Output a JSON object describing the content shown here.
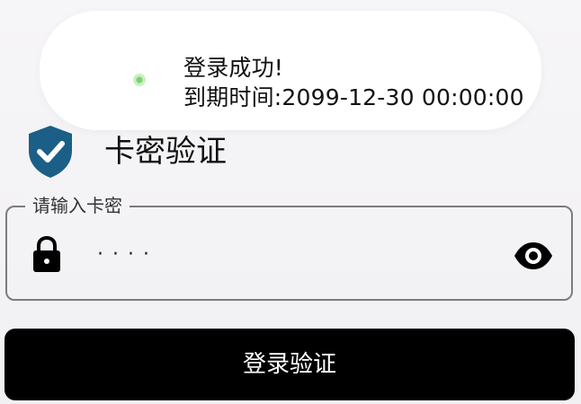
{
  "toast": {
    "icon": "app-icon",
    "line1": "登录成功!",
    "line2": "到期时间:2099-12-30 00:00:00"
  },
  "header": {
    "icon": "shield-check-icon",
    "title": "卡密验证"
  },
  "card_input": {
    "label": "请输入卡密",
    "masked_value": "····",
    "leading_icon": "lock-icon",
    "trailing_icon": "eye-icon"
  },
  "login_button": {
    "label": "登录验证"
  },
  "colors": {
    "accent": "#1b5f86",
    "button": "#000000",
    "background": "#f3f2f4"
  }
}
